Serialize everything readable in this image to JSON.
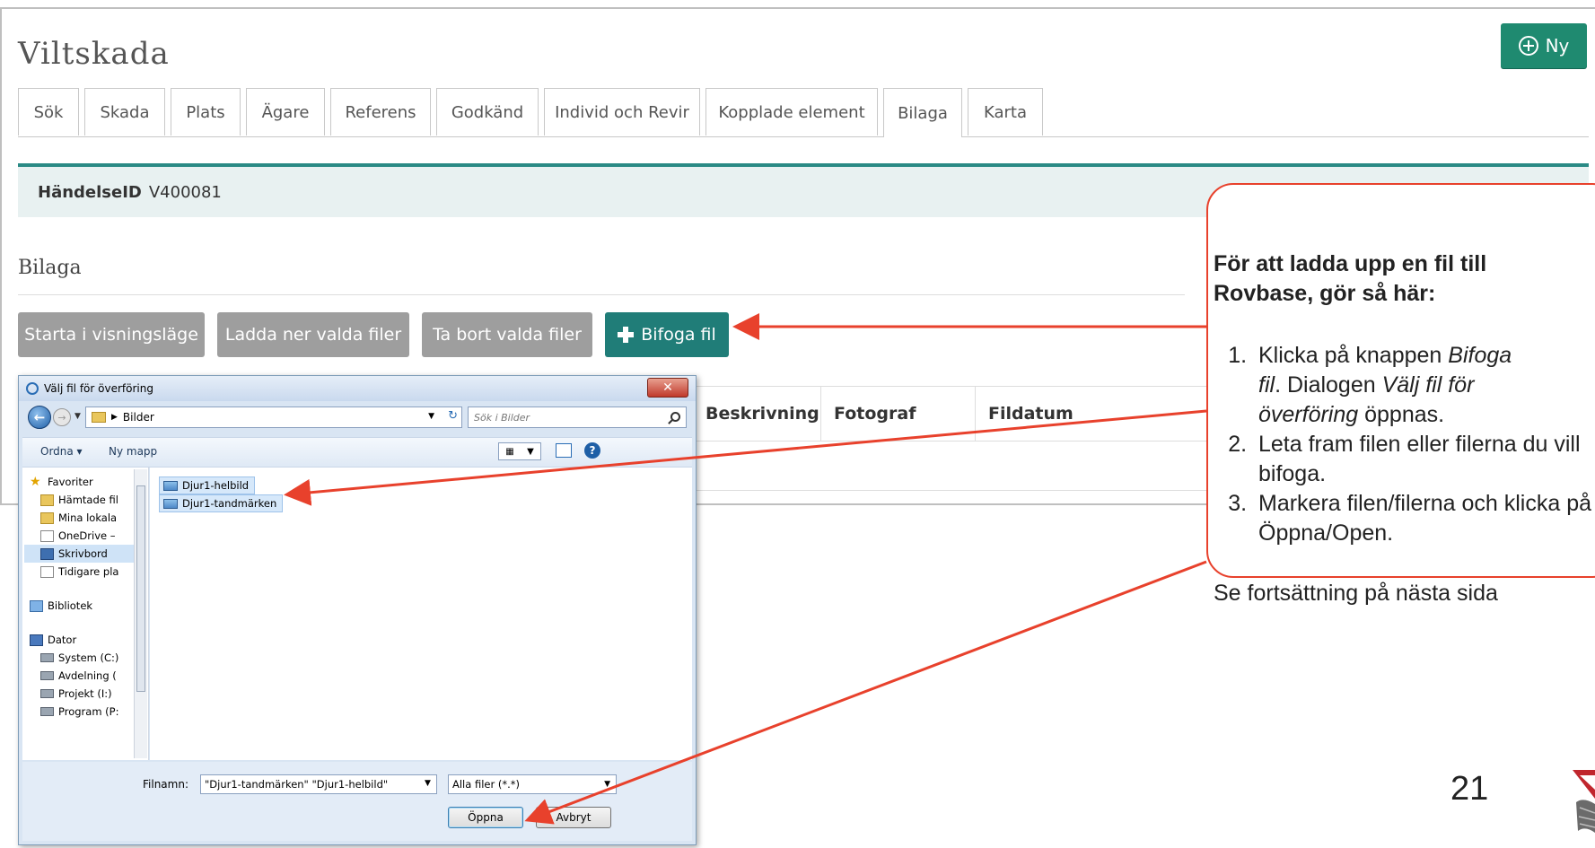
{
  "app": {
    "title": "Viltskada",
    "new_button_label": "Ny",
    "tabs": [
      {
        "label": "Sök"
      },
      {
        "label": "Skada"
      },
      {
        "label": "Plats"
      },
      {
        "label": "Ägare"
      },
      {
        "label": "Referens"
      },
      {
        "label": "Godkänd"
      },
      {
        "label": "Individ och Revir"
      },
      {
        "label": "Kopplade element"
      },
      {
        "label": "Bilaga",
        "active": true
      },
      {
        "label": "Karta"
      }
    ],
    "event_label": "HändelseID",
    "event_id": "V400081",
    "section_title": "Bilaga",
    "actions": {
      "start_view": "Starta i visningsläge",
      "download": "Ladda ner valda filer",
      "delete": "Ta bort valda filer",
      "attach": "Bifoga fil"
    },
    "columns": [
      "Beskrivning",
      "Fotograf",
      "Fildatum"
    ]
  },
  "callout": {
    "heading_line1": "För att ladda upp en fil till",
    "heading_line2": "Rovbase, gör så här:",
    "step1_a": "Klicka på knappen ",
    "step1_b": "Bifoga",
    "step1_c": "fil",
    "step1_d": ". Dialogen ",
    "step1_e": "Välj fil för",
    "step1_f": "överföring",
    "step1_g": " öppnas.",
    "step2": "Leta fram filen eller filerna du vill bifoga.",
    "step3": "Markera filen/filerna och klicka på Öppna/Open.",
    "footer": "Se fortsättning på nästa sida"
  },
  "page_number": "21",
  "dialog": {
    "title": "Välj fil för överföring",
    "path": "Bilder",
    "search_placeholder": "Sök i Bilder",
    "toolbar": {
      "organize": "Ordna ▾",
      "new_folder": "Ny mapp"
    },
    "nav_items": [
      {
        "label": "Favoriter",
        "icon": "star-icon"
      },
      {
        "label": "Hämtade fil",
        "icon": "folder-icon"
      },
      {
        "label": "Mina lokala",
        "icon": "folder-icon"
      },
      {
        "label": "OneDrive –",
        "icon": "document-icon"
      },
      {
        "label": "Skrivbord",
        "icon": "desktop-icon",
        "selected": true
      },
      {
        "label": "Tidigare pla",
        "icon": "document-icon"
      },
      {
        "label": "Bibliotek",
        "icon": "library-icon"
      },
      {
        "label": "Dator",
        "icon": "computer-icon"
      },
      {
        "label": "System (C:)",
        "icon": "drive-icon"
      },
      {
        "label": "Avdelning (",
        "icon": "drive-icon"
      },
      {
        "label": "Projekt (I:)",
        "icon": "drive-icon"
      },
      {
        "label": "Program (P:",
        "icon": "drive-icon"
      }
    ],
    "files": [
      "Djur1-helbild",
      "Djur1-tandmärken"
    ],
    "filename_label": "Filnamn:",
    "filename_value": "\"Djur1-tandmärken\" \"Djur1-helbild\"",
    "filetype": "Alla filer (*.*)",
    "open_button": "Öppna",
    "cancel_button": "Avbryt"
  },
  "colors": {
    "accent_teal": "#207d78",
    "callout_border": "#e8412c",
    "arrow": "#e8412c"
  }
}
